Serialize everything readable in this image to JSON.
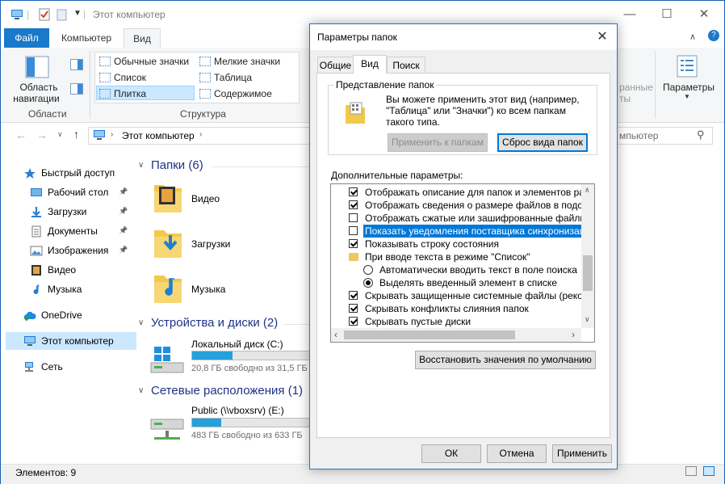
{
  "window": {
    "title": "Этот компьютер",
    "controls": {
      "minimize": "—",
      "maximize": "☐",
      "close": "✕"
    }
  },
  "ribbon": {
    "tabs": [
      "Файл",
      "Компьютер",
      "Вид"
    ],
    "nav_pane_label_1": "Область",
    "nav_pane_label_2": "навигации",
    "areas_group": "Области",
    "layout_group": "Структура",
    "layout_items": [
      "Обычные значки",
      "Мелкие значки",
      "Список",
      "Таблица",
      "Плитка",
      "Содержимое"
    ],
    "params_label": "Параметры",
    "partial_1": "ранные",
    "partial_2": "ты"
  },
  "address": {
    "path": "Этот компьютер",
    "search_placeholder": "Поиск: Этот компьютер",
    "search_visible": "мпьютер"
  },
  "nav": {
    "items": [
      {
        "label": "Быстрый доступ",
        "icon": "star-icon"
      },
      {
        "label": "Рабочий стол",
        "icon": "desktop-icon",
        "pinned": true
      },
      {
        "label": "Загрузки",
        "icon": "download-icon",
        "pinned": true
      },
      {
        "label": "Документы",
        "icon": "document-icon",
        "pinned": true
      },
      {
        "label": "Изображения",
        "icon": "image-icon",
        "pinned": true
      },
      {
        "label": "Видео",
        "icon": "video-icon"
      },
      {
        "label": "Музыка",
        "icon": "music-icon"
      },
      {
        "label": "OneDrive",
        "icon": "cloud-icon"
      },
      {
        "label": "Этот компьютер",
        "icon": "computer-icon"
      },
      {
        "label": "Сеть",
        "icon": "network-icon"
      }
    ]
  },
  "content": {
    "folders_header": "Папки (6)",
    "folders": [
      "Видео",
      "Загрузки",
      "Музыка"
    ],
    "devices_header": "Устройства и диски (2)",
    "local_disk": {
      "name": "Локальный диск (C:)",
      "free": "20,8 ГБ свободно из 31,5 ГБ",
      "used_fraction": 0.34
    },
    "network_header": "Сетевые расположения (1)",
    "net_drive": {
      "name": "Public (\\\\vboxsrv) (E:)",
      "free": "483 ГБ свободно из 633 ГБ",
      "used_fraction": 0.24
    }
  },
  "status": {
    "items": "Элементов: 9"
  },
  "dialog": {
    "title": "Параметры папок",
    "tabs": [
      "Общие",
      "Вид",
      "Поиск"
    ],
    "folder_view_legend": "Представление папок",
    "folder_view_text": "Вы можете применить этот вид (например, \"Таблица\" или \"Значки\") ко всем папкам такого типа.",
    "apply_button": "Применить к папкам",
    "reset_button": "Сброс вида папок",
    "advanced_label": "Дополнительные параметры:",
    "advanced_items": [
      {
        "type": "check",
        "on": true,
        "label": "Отображать описание для папок и элементов рабоче",
        "indent": 0
      },
      {
        "type": "check",
        "on": true,
        "label": "Отображать сведения о размере файлов в подсказк",
        "indent": 0
      },
      {
        "type": "check",
        "on": false,
        "label": "Отображать сжатые или зашифрованные файлы NTI",
        "indent": 0
      },
      {
        "type": "check",
        "on": false,
        "label": "Показать уведомления поставщика синхронизации",
        "indent": 0,
        "selected": true
      },
      {
        "type": "check",
        "on": true,
        "label": "Показывать строку состояния",
        "indent": 0
      },
      {
        "type": "folder",
        "label": "При вводе текста в режиме \"Список\"",
        "indent": 0
      },
      {
        "type": "radio",
        "on": false,
        "label": "Автоматически вводить текст в поле поиска",
        "indent": 1
      },
      {
        "type": "radio",
        "on": true,
        "label": "Выделять введенный элемент в списке",
        "indent": 1
      },
      {
        "type": "check",
        "on": true,
        "label": "Скрывать защищенные системные файлы (рекомен",
        "indent": 0
      },
      {
        "type": "check",
        "on": true,
        "label": "Скрывать конфликты слияния папок",
        "indent": 0
      },
      {
        "type": "check",
        "on": true,
        "label": "Скрывать пустые диски",
        "indent": 0
      }
    ],
    "restore_button": "Восстановить значения по умолчанию",
    "ok_button": "ОК",
    "cancel_button": "Отмена",
    "apply_main_button": "Применить"
  }
}
